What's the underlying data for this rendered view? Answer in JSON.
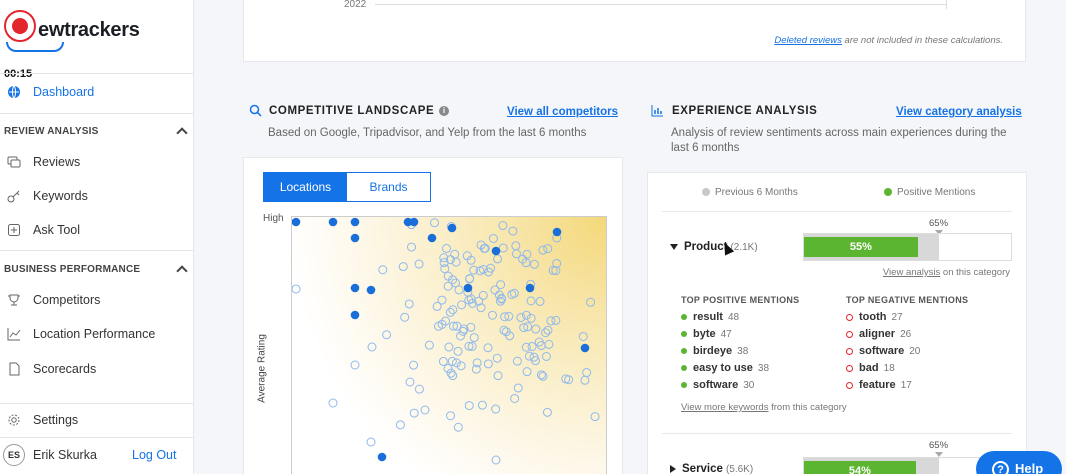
{
  "app": {
    "logo_text": "ewtrackers",
    "timer": "00:15"
  },
  "sidebar": {
    "dashboard": "Dashboard",
    "section_review": "REVIEW ANALYSIS",
    "reviews": "Reviews",
    "keywords": "Keywords",
    "ask_tool": "Ask Tool",
    "section_business": "BUSINESS PERFORMANCE",
    "competitors": "Competitors",
    "location_performance": "Location Performance",
    "scorecards": "Scorecards",
    "settings": "Settings",
    "user_initials": "ES",
    "user_name": "Erik Skurka",
    "logout": "Log Out"
  },
  "top_card": {
    "year": "2022",
    "deleted_link": "Deleted reviews",
    "deleted_rest": " are not included in these calculations."
  },
  "competitive": {
    "title": "COMPETITIVE LANDSCAPE",
    "link": "View all competitors",
    "subtitle": "Based on Google, Tripadvisor, and Yelp from the last 6 months",
    "tab_locations": "Locations",
    "tab_brands": "Brands",
    "y_high": "High",
    "y_label": "Average Rating"
  },
  "experience": {
    "title": "EXPERIENCE ANALYSIS",
    "link": "View category analysis",
    "subtitle": "Analysis of review sentiments across main experiences during the last 6 months",
    "legend_prev": "Previous 6 Months",
    "legend_pos": "Positive Mentions",
    "colors": {
      "positive": "#5cb531",
      "previous": "#c8c8c8",
      "negative": "#e3262e"
    },
    "product": {
      "name": "Product",
      "count": "(2.1K)",
      "prev_label": "65%",
      "prev_value": 65,
      "pos_label": "55%",
      "pos_value": 55,
      "view_link": "View analysis",
      "view_rest": " on this category"
    },
    "top_positive_title": "TOP POSITIVE MENTIONS",
    "top_negative_title": "TOP NEGATIVE MENTIONS",
    "positive": [
      {
        "word": "result",
        "n": "48"
      },
      {
        "word": "byte",
        "n": "47"
      },
      {
        "word": "birdeye",
        "n": "38"
      },
      {
        "word": "easy to use",
        "n": "38"
      },
      {
        "word": "software",
        "n": "30"
      }
    ],
    "negative": [
      {
        "word": "tooth",
        "n": "27"
      },
      {
        "word": "aligner",
        "n": "26"
      },
      {
        "word": "software",
        "n": "20"
      },
      {
        "word": "bad",
        "n": "18"
      },
      {
        "word": "feature",
        "n": "17"
      }
    ],
    "view_more_link": "View more keywords",
    "view_more_rest": " from this category",
    "service": {
      "name": "Service",
      "count": "(5.6K)",
      "prev_label": "65%",
      "prev_value": 65,
      "pos_label": "54%",
      "pos_value": 54
    }
  },
  "help": "Help"
}
